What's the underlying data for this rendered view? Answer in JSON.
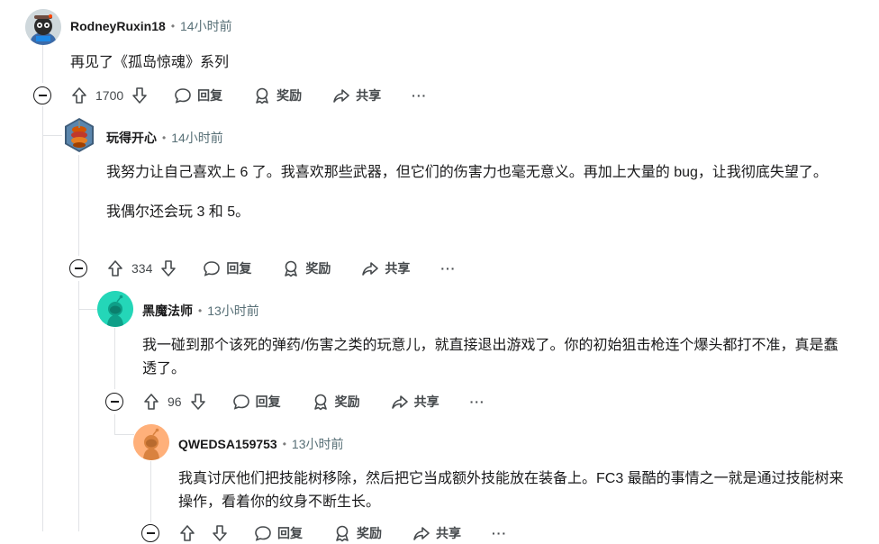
{
  "comments": [
    {
      "author": "RodneyRuxin18",
      "time": "14小时前",
      "paragraphs": [
        "再见了《孤岛惊魂》系列"
      ],
      "votes": "1700",
      "reply_label": "回复",
      "award_label": "奖励",
      "share_label": "共享",
      "more_label": "···"
    },
    {
      "author": "玩得开心",
      "time": "14小时前",
      "paragraphs": [
        "我努力让自己喜欢上 6 了。我喜欢那些武器，但它们的伤害力也毫无意义。再加上大量的 bug，让我彻底失望了。",
        "我偶尔还会玩 3 和 5。"
      ],
      "votes": "334",
      "reply_label": "回复",
      "award_label": "奖励",
      "share_label": "共享",
      "more_label": "···"
    },
    {
      "author": "黑魔法师",
      "time": "13小时前",
      "paragraphs": [
        "我一碰到那个该死的弹药/伤害之类的玩意儿，就直接退出游戏了。你的初始狙击枪连个爆头都打不准，真是蠢透了。"
      ],
      "votes": "96",
      "reply_label": "回复",
      "award_label": "奖励",
      "share_label": "共享",
      "more_label": "···"
    },
    {
      "author": "QWEDSA159753",
      "time": "13小时前",
      "paragraphs": [
        "我真讨厌他们把技能树移除，然后把它当成额外技能放在装备上。FC3 最酷的事情之一就是通过技能树来操作，看着你的纹身不断生长。"
      ],
      "votes": "",
      "reply_label": "回复",
      "award_label": "奖励",
      "share_label": "共享",
      "more_label": "···"
    }
  ],
  "icons": {
    "upvote": "arrow-up-icon",
    "downvote": "arrow-down-icon",
    "reply": "speech-bubble-icon",
    "award": "award-icon",
    "share": "share-arrow-icon",
    "collapse": "minus-circle-icon"
  },
  "colors": {
    "thread_line": "#e1e3e6",
    "meta_gray": "#576f76",
    "text": "#1a1a1b"
  }
}
